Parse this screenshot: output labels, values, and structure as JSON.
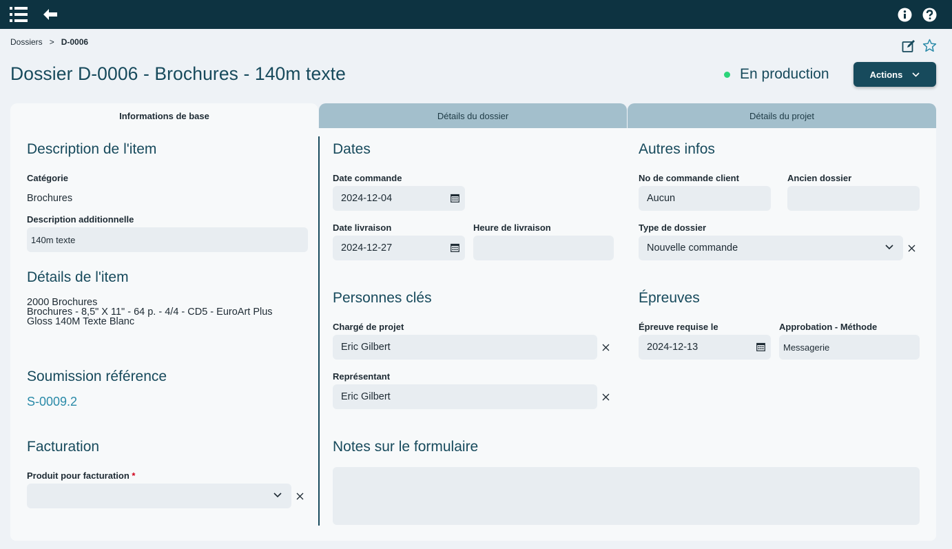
{
  "topbar": {
    "menu_icon": "list-icon",
    "back_icon": "arrow-left-icon",
    "info_icon": "info-icon",
    "help_icon": "help-icon"
  },
  "breadcrumb": {
    "parent": "Dossiers",
    "separator": ">",
    "current": "D-0006"
  },
  "header": {
    "title": "Dossier D-0006 - Brochures - 140m texte",
    "status": "En production",
    "status_color": "#2bd47a",
    "actions_label": "Actions",
    "edit_icon": "edit-icon",
    "favorite_icon": "star-icon"
  },
  "tabs": [
    {
      "label": "Informations de base",
      "active": true
    },
    {
      "label": "Détails du dossier",
      "active": false
    },
    {
      "label": "Détails du projet",
      "active": false
    }
  ],
  "description_item": {
    "heading": "Description de l'item",
    "category_label": "Catégorie",
    "category_value": "Brochures",
    "additional_label": "Description additionnelle",
    "additional_value": "140m texte"
  },
  "details_item": {
    "heading": "Détails de l'item",
    "lines": [
      "2000 Brochures",
      "Brochures - 8,5\" X 11\" - 64 p. - 4/4 - CD5 - EuroArt Plus",
      "Gloss 140M Texte Blanc"
    ]
  },
  "soumission": {
    "heading": "Soumission référence",
    "link": "S-0009.2"
  },
  "facturation": {
    "heading": "Facturation",
    "product_label": "Produit pour facturation",
    "required_mark": "*",
    "product_value": ""
  },
  "dates": {
    "heading": "Dates",
    "order_label": "Date commande",
    "order_value": "2024-12-04",
    "delivery_label": "Date livraison",
    "delivery_value": "2024-12-27",
    "time_label": "Heure de livraison",
    "time_value": ""
  },
  "autres": {
    "heading": "Autres infos",
    "client_order_label": "No de commande client",
    "client_order_value": "Aucun",
    "old_file_label": "Ancien dossier",
    "old_file_value": "",
    "type_label": "Type de dossier",
    "type_value": "Nouvelle commande"
  },
  "personnes": {
    "heading": "Personnes clés",
    "manager_label": "Chargé de projet",
    "manager_value": "Eric Gilbert",
    "rep_label": "Représentant",
    "rep_value": "Eric Gilbert"
  },
  "epreuves": {
    "heading": "Épreuves",
    "required_label": "Épreuve requise le",
    "required_value": "2024-12-13",
    "method_label": "Approbation - Méthode",
    "method_value": "Messagerie"
  },
  "notes": {
    "heading": "Notes sur le formulaire",
    "value": ""
  }
}
